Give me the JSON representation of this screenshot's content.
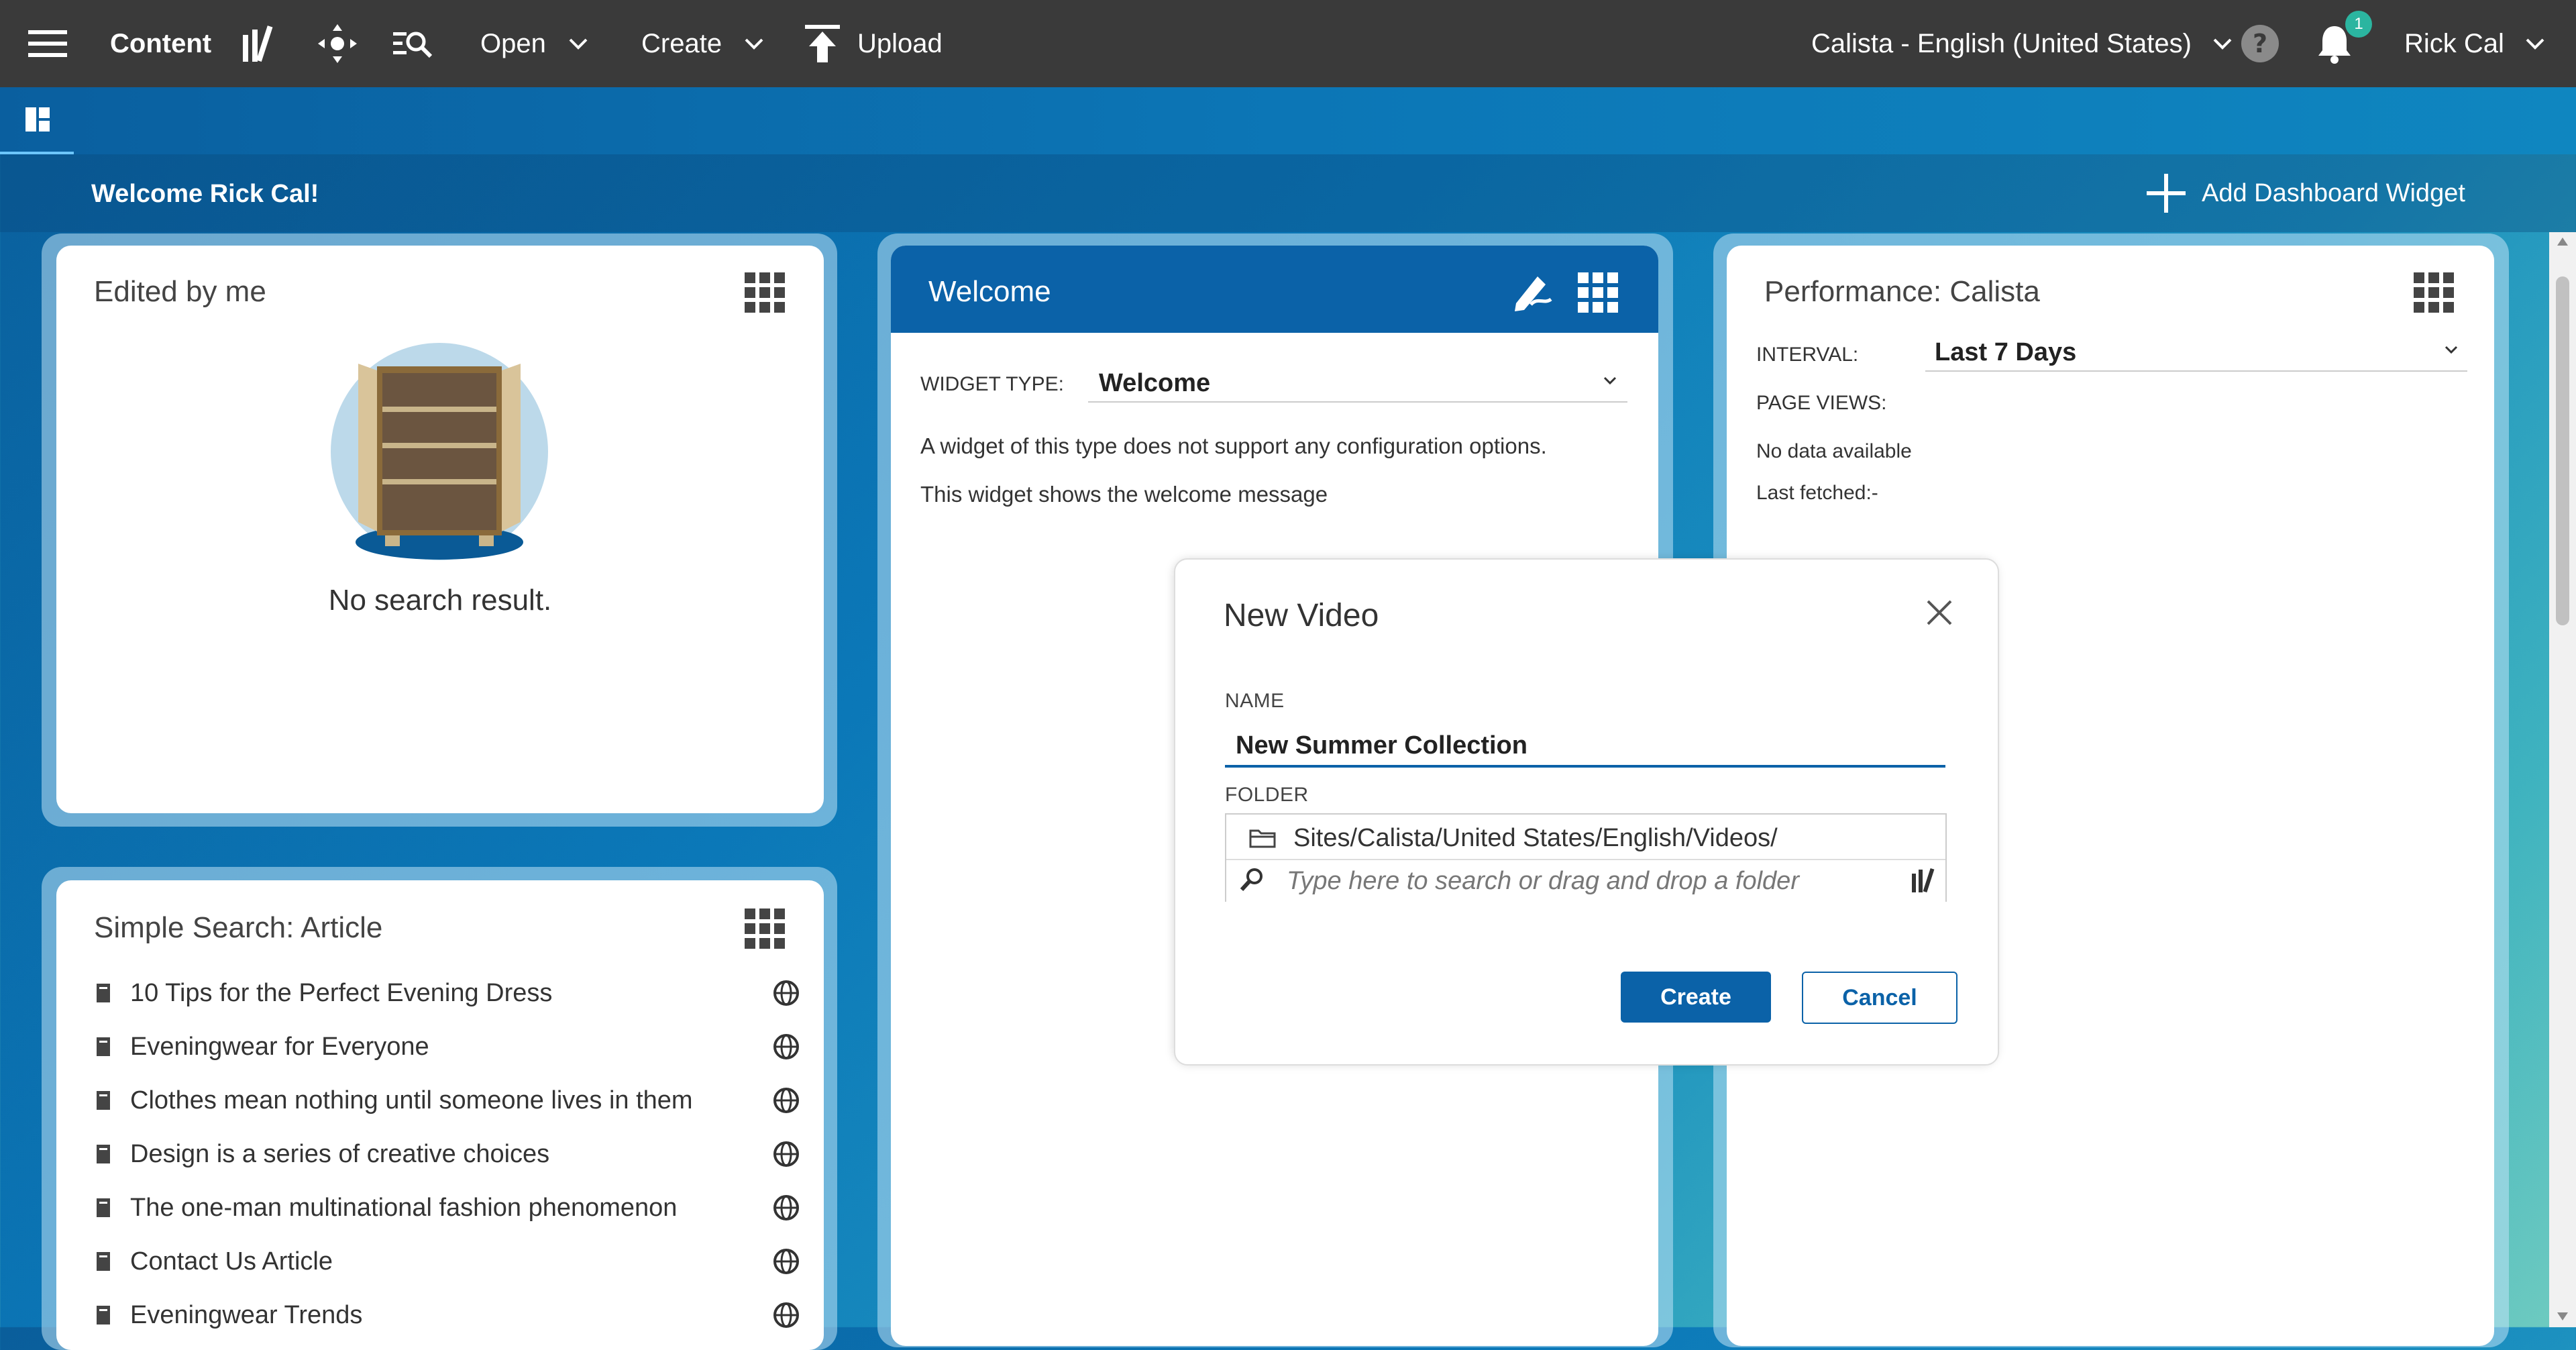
{
  "topbar": {
    "content_label": "Content",
    "open_label": "Open",
    "create_label": "Create",
    "upload_label": "Upload",
    "site_locale": "Calista - English (United States)",
    "notification_count": "1",
    "user_name": "Rick Cal"
  },
  "welcome": {
    "message": "Welcome Rick Cal!",
    "add_widget_label": "Add Dashboard Widget"
  },
  "edited_by_me": {
    "title": "Edited by me",
    "empty_text": "No search result."
  },
  "simple_search": {
    "title": "Simple Search: Article",
    "items": [
      "10 Tips for the Perfect Evening Dress",
      "Eveningwear for Everyone",
      "Clothes mean nothing until someone lives in them",
      "Design is a series of creative choices",
      "The one-man multinational fashion phenomenon",
      "Contact Us Article",
      "Eveningwear Trends"
    ]
  },
  "welcome_widget": {
    "title": "Welcome",
    "widget_type_label": "WIDGET TYPE:",
    "widget_type_value": "Welcome",
    "line1": "A widget of this type does not support any configuration options.",
    "line2": "This widget shows the welcome message"
  },
  "performance": {
    "title": "Performance: Calista",
    "interval_label": "INTERVAL:",
    "interval_value": "Last 7 Days",
    "page_views_label": "PAGE VIEWS:",
    "no_data": "No data available",
    "last_fetched": "Last fetched:-"
  },
  "dialog": {
    "title": "New Video",
    "name_label": "NAME",
    "name_value": "New Summer Collection",
    "folder_label": "FOLDER",
    "folder_path": "Sites/Calista/United States/English/Videos/",
    "folder_search_placeholder": "Type here to search or drag and drop a folder",
    "create_label": "Create",
    "cancel_label": "Cancel"
  },
  "colors": {
    "topbar": "#3a3a3a",
    "primary": "#0b62a8",
    "badge": "#2bb5a0"
  }
}
